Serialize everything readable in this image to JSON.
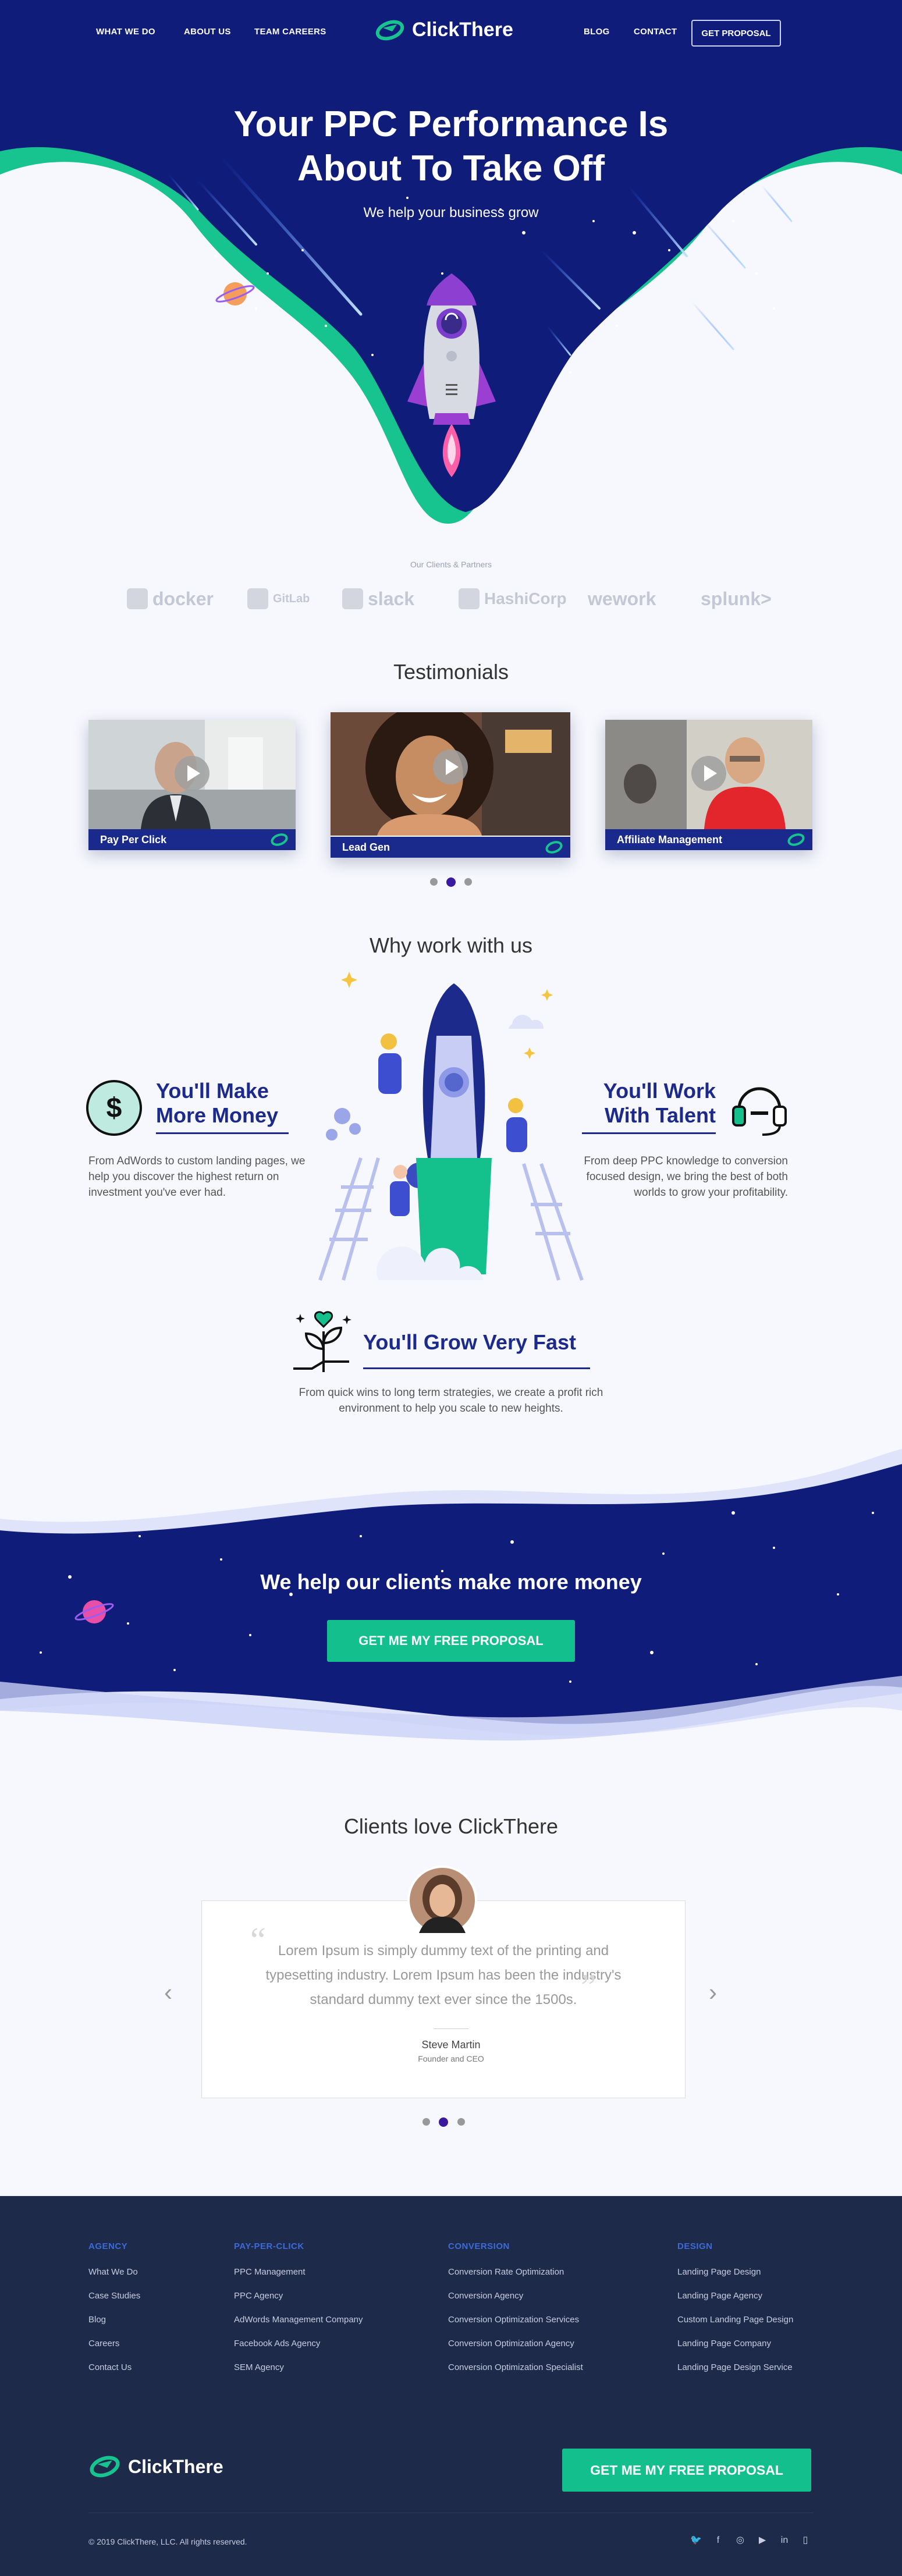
{
  "nav": {
    "left": [
      "WHAT WE DO",
      "ABOUT US",
      "TEAM CAREERS"
    ],
    "right": [
      "BLOG",
      "CONTACT"
    ],
    "proposal": "GET PROPOSAL",
    "logo": "ClickThere"
  },
  "hero": {
    "title_line1": "Your PPC Performance Is",
    "title_line2": "About To Take Off",
    "subtitle": "We help your business grow"
  },
  "partners": {
    "label": "Our Clients & Partners",
    "items": [
      "docker",
      "GitLab",
      "slack",
      "HashiCorp",
      "wework",
      "splunk>"
    ]
  },
  "testimonials": {
    "title": "Testimonials",
    "cards": [
      "Pay Per Click",
      "Lead Gen",
      "Affiliate Management"
    ]
  },
  "why": {
    "title": "Why work with us",
    "money": {
      "title1": "You'll Make",
      "title2": "More Money",
      "text": "From AdWords to custom landing pages, we help you discover the highest return on investment you've ever had."
    },
    "talent": {
      "title1": "You'll Work",
      "title2": "With Talent",
      "text": "From deep PPC knowledge to conversion focused design, we bring the best of both worlds to grow your profitability."
    },
    "grow": {
      "title": "You'll Grow Very Fast",
      "text1": "From quick wins to long term strategies, we create a profit rich",
      "text2": "environment to help you scale to new heights."
    }
  },
  "cta": {
    "title": "We help our clients make more money",
    "button": "GET ME MY FREE PROPOSAL"
  },
  "reviews": {
    "title": "Clients love ClickThere",
    "text1": "Lorem Ipsum is simply dummy text of the printing and",
    "text2": "typesetting industry. Lorem Ipsum has been the industry's",
    "text3": "standard dummy text ever since the 1500s.",
    "name": "Steve Martin",
    "role": "Founder and CEO"
  },
  "footer": {
    "columns": [
      {
        "head": "AGENCY",
        "links": [
          "What We Do",
          "Case Studies",
          "Blog",
          "Careers",
          "Contact Us"
        ]
      },
      {
        "head": "PAY-PER-CLICK",
        "links": [
          "PPC Management",
          "PPC Agency",
          "AdWords Management Company",
          "Facebook Ads Agency",
          "SEM Agency"
        ]
      },
      {
        "head": "CONVERSION",
        "links": [
          "Conversion Rate Optimization",
          "Conversion Agency",
          "Conversion Optimization Services",
          "Conversion Optimization Agency",
          "Conversion Optimization Specialist"
        ]
      },
      {
        "head": "DESIGN",
        "links": [
          "Landing Page Design",
          "Landing Page Agency",
          "Custom Landing Page Design",
          "Landing Page Company",
          "Landing Page Design Service"
        ]
      }
    ],
    "logo": "ClickThere",
    "button": "GET ME MY FREE PROPOSAL",
    "copyright": "© 2019 ClickThere, LLC. All rights reserved.",
    "social": [
      "twitter-icon",
      "facebook-icon",
      "instagram-icon",
      "youtube-icon",
      "linkedin-icon",
      "mobile-icon"
    ]
  },
  "colors": {
    "navy": "#0f1c7a",
    "green": "#13c08d",
    "footer": "#1e2a4a",
    "accent": "#1c2a8c"
  }
}
